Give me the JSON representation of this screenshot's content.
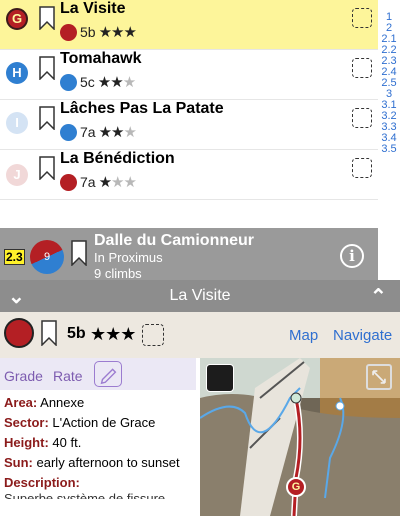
{
  "climbs": [
    {
      "letter": "G",
      "name": "La Visite",
      "type": "trad",
      "grade": "5b",
      "stars": 3,
      "selected": true
    },
    {
      "letter": "H",
      "name": "Tomahawk",
      "type": "sport",
      "grade": "5c",
      "stars": 2
    },
    {
      "letter": "I",
      "name": "Lâches Pas La Patate",
      "type": "sport",
      "grade": "7a",
      "stars": 2
    },
    {
      "letter": "J",
      "name": "La Bénédiction",
      "type": "trad",
      "grade": "7a",
      "stars": 1
    }
  ],
  "index": [
    "1",
    "2",
    "2.1",
    "2.2",
    "2.3",
    "2.4",
    "2.5",
    "3",
    "3.1",
    "3.2",
    "3.3",
    "3.4",
    "3.5"
  ],
  "area": {
    "grade_badge": "2.3",
    "count_number": "9",
    "name": "Dalle du Camionneur",
    "sub": "In Proximus",
    "climbs": "9 climbs"
  },
  "detail": {
    "title": "La Visite",
    "grade": "5b",
    "stars": "★★★",
    "map": "Map",
    "navigate": "Navigate",
    "grade_label": "Grade",
    "rate_label": "Rate",
    "area_label": "Area:",
    "area_value": "Annexe",
    "sector_label": "Sector:",
    "sector_value": "L'Action de Grace",
    "height_label": "Height:",
    "height_value": "40 ft.",
    "sun_label": "Sun:",
    "sun_value": "early afternoon to sunset",
    "description_label": "Description:",
    "description_value": "Superbe système de fissure"
  },
  "photo": {
    "marker_letter": "G"
  },
  "colors": {
    "selected_row": "#fdf59a",
    "trad": "#b41f24",
    "sport": "#2f7fd1",
    "link": "#2f6fd0"
  }
}
